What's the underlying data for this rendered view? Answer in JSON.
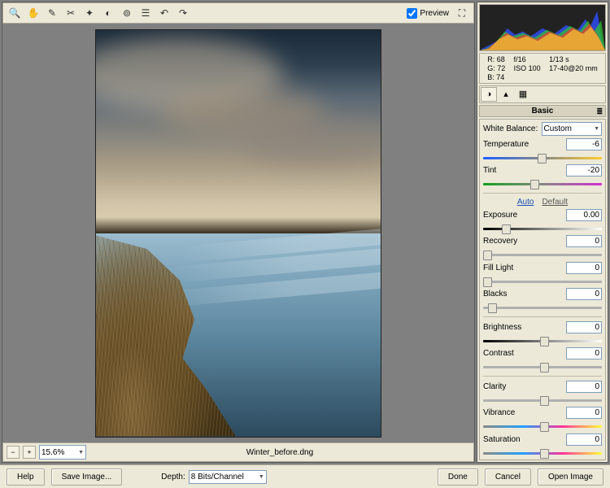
{
  "toolbar": {
    "preview_label": "Preview"
  },
  "status": {
    "zoom": "15.6%",
    "filename": "Winter_before.dng"
  },
  "readout": {
    "r_label": "R:",
    "g_label": "G:",
    "b_label": "B:",
    "r": "68",
    "g": "72",
    "b": "74",
    "aperture": "f/16",
    "shutter": "1/13 s",
    "iso": "ISO 100",
    "lens": "17-40@20 mm"
  },
  "panel": {
    "title": "Basic",
    "wb_label": "White Balance:",
    "wb_value": "Custom",
    "auto_label": "Auto",
    "default_label": "Default",
    "sliders": [
      {
        "label": "Temperature",
        "value": "-6"
      },
      {
        "label": "Tint",
        "value": "-20"
      },
      {
        "label": "Exposure",
        "value": "0.00"
      },
      {
        "label": "Recovery",
        "value": "0"
      },
      {
        "label": "Fill Light",
        "value": "0"
      },
      {
        "label": "Blacks",
        "value": "0"
      },
      {
        "label": "Brightness",
        "value": "0"
      },
      {
        "label": "Contrast",
        "value": "0"
      },
      {
        "label": "Clarity",
        "value": "0"
      },
      {
        "label": "Vibrance",
        "value": "0"
      },
      {
        "label": "Saturation",
        "value": "0"
      }
    ]
  },
  "footer": {
    "help": "Help",
    "save_image": "Save Image...",
    "depth_label": "Depth:",
    "depth_value": "8 Bits/Channel",
    "done": "Done",
    "cancel": "Cancel",
    "open_image": "Open Image"
  }
}
